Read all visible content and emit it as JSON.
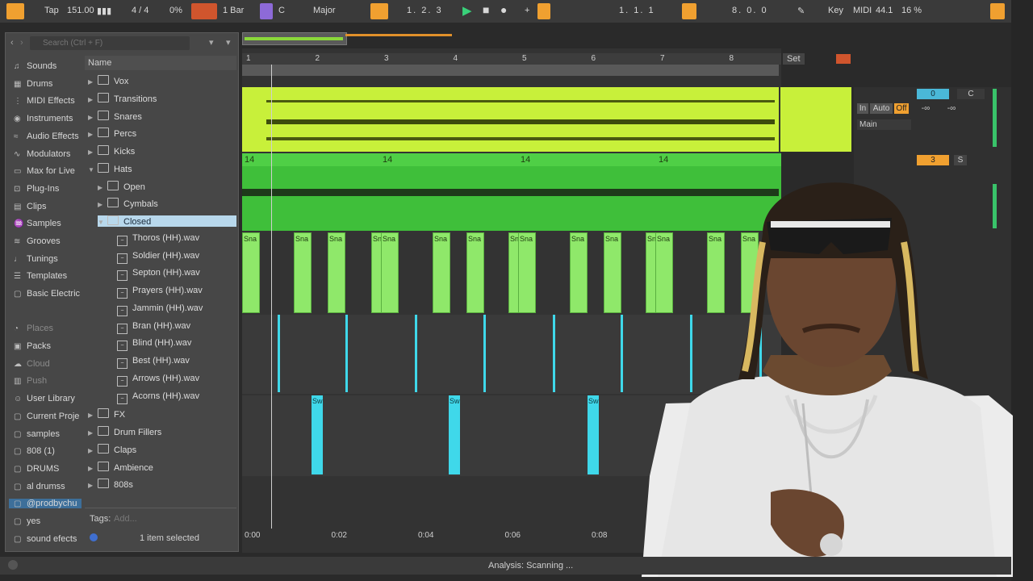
{
  "transport": {
    "tap": "Tap",
    "tempo": "151.00",
    "time_sig": "4 / 4",
    "groove": "0%",
    "quant": "1 Bar",
    "key": "C",
    "scale": "Major",
    "position": "1.  2.  3",
    "loop_start": "1.  1.  1",
    "loop_len": "8.  0.  0",
    "key_label": "Key",
    "midi_label": "MIDI",
    "sample_rate": "44.1",
    "cpu": "16 %"
  },
  "browser": {
    "search_placeholder": "Search (Ctrl + F)",
    "column_header": "Name",
    "collections": [
      {
        "label": "Sounds",
        "icon": "music-note-icon"
      },
      {
        "label": "Drums",
        "icon": "grid-icon"
      },
      {
        "label": "MIDI Effects",
        "icon": "midi-icon"
      },
      {
        "label": "Instruments",
        "icon": "instrument-icon"
      },
      {
        "label": "Audio Effects",
        "icon": "audio-effect-icon"
      },
      {
        "label": "Modulators",
        "icon": "modulator-icon"
      },
      {
        "label": "Max for Live",
        "icon": "max-icon"
      },
      {
        "label": "Plug-Ins",
        "icon": "plugin-icon"
      },
      {
        "label": "Clips",
        "icon": "clip-icon"
      },
      {
        "label": "Samples",
        "icon": "waveform-icon"
      },
      {
        "label": "Grooves",
        "icon": "groove-icon"
      },
      {
        "label": "Tunings",
        "icon": "tuning-icon"
      },
      {
        "label": "Templates",
        "icon": "template-icon"
      },
      {
        "label": "Basic Electric",
        "icon": "folder-icon"
      }
    ],
    "places_header": "Places",
    "places": [
      {
        "label": "Packs",
        "icon": "pack-icon"
      },
      {
        "label": "Cloud",
        "icon": "cloud-icon"
      },
      {
        "label": "Push",
        "icon": "push-icon"
      },
      {
        "label": "User Library",
        "icon": "user-icon"
      },
      {
        "label": "Current Proje",
        "icon": "folder-icon"
      },
      {
        "label": "samples",
        "icon": "folder-icon"
      },
      {
        "label": "808 (1)",
        "icon": "folder-icon"
      },
      {
        "label": "DRUMS",
        "icon": "folder-icon"
      },
      {
        "label": "al drumss",
        "icon": "folder-icon"
      },
      {
        "label": "@prodbychu",
        "icon": "folder-icon"
      },
      {
        "label": "yes",
        "icon": "folder-icon"
      },
      {
        "label": "sound efects",
        "icon": "folder-icon"
      }
    ],
    "tree": [
      {
        "label": "Vox",
        "type": "folder",
        "indent": 0,
        "expanded": false
      },
      {
        "label": "Transitions",
        "type": "folder",
        "indent": 0,
        "expanded": false
      },
      {
        "label": "Snares",
        "type": "folder",
        "indent": 0,
        "expanded": false
      },
      {
        "label": "Percs",
        "type": "folder",
        "indent": 0,
        "expanded": false
      },
      {
        "label": "Kicks",
        "type": "folder",
        "indent": 0,
        "expanded": false
      },
      {
        "label": "Hats",
        "type": "folder",
        "indent": 0,
        "expanded": true
      },
      {
        "label": "Open",
        "type": "folder",
        "indent": 1,
        "expanded": false
      },
      {
        "label": "Cymbals",
        "type": "folder",
        "indent": 1,
        "expanded": false
      },
      {
        "label": "Closed",
        "type": "folder",
        "indent": 1,
        "expanded": true,
        "selected": true
      },
      {
        "label": "Thoros (HH).wav",
        "type": "file",
        "indent": 2
      },
      {
        "label": "Soldier (HH).wav",
        "type": "file",
        "indent": 2
      },
      {
        "label": "Septon (HH).wav",
        "type": "file",
        "indent": 2
      },
      {
        "label": "Prayers (HH).wav",
        "type": "file",
        "indent": 2
      },
      {
        "label": "Jammin (HH).wav",
        "type": "file",
        "indent": 2
      },
      {
        "label": "Bran (HH).wav",
        "type": "file",
        "indent": 2
      },
      {
        "label": "Blind (HH).wav",
        "type": "file",
        "indent": 2
      },
      {
        "label": "Best (HH).wav",
        "type": "file",
        "indent": 2
      },
      {
        "label": "Arrows (HH).wav",
        "type": "file",
        "indent": 2
      },
      {
        "label": "Acorns (HH).wav",
        "type": "file",
        "indent": 2
      },
      {
        "label": "FX",
        "type": "folder",
        "indent": 0,
        "expanded": false
      },
      {
        "label": "Drum Fillers",
        "type": "folder",
        "indent": 0,
        "expanded": false
      },
      {
        "label": "Claps",
        "type": "folder",
        "indent": 0,
        "expanded": false
      },
      {
        "label": "Ambience",
        "type": "folder",
        "indent": 0,
        "expanded": false
      },
      {
        "label": "808s",
        "type": "folder",
        "indent": 0,
        "expanded": false
      }
    ],
    "tags_label": "Tags:",
    "tags_placeholder": "Add...",
    "selection_status": "1 item selected"
  },
  "arrangement": {
    "bar_numbers": [
      "1",
      "2",
      "3",
      "4",
      "5",
      "6",
      "7",
      "8"
    ],
    "time_labels": [
      "0:00",
      "0:02",
      "0:04",
      "0:06",
      "0:08"
    ],
    "clip_numbers": [
      "14",
      "14",
      "14",
      "14"
    ],
    "snare_label": "Sna",
    "swell_label": "Sw",
    "set_label": "Set"
  },
  "mixer": {
    "in_label": "In",
    "auto_label": "Auto",
    "off_label": "Off",
    "output": "Main",
    "track1_value": "0",
    "pan_c": "C",
    "inf": "-∞",
    "track2_num": "3",
    "solo": "S"
  },
  "status": {
    "analysis": "Analysis: Scanning ..."
  },
  "colors": {
    "accent_orange": "#f0a030",
    "clip_lime": "#c8f03a",
    "clip_green": "#3fbf3a",
    "clip_cyan": "#3fd8ea"
  }
}
